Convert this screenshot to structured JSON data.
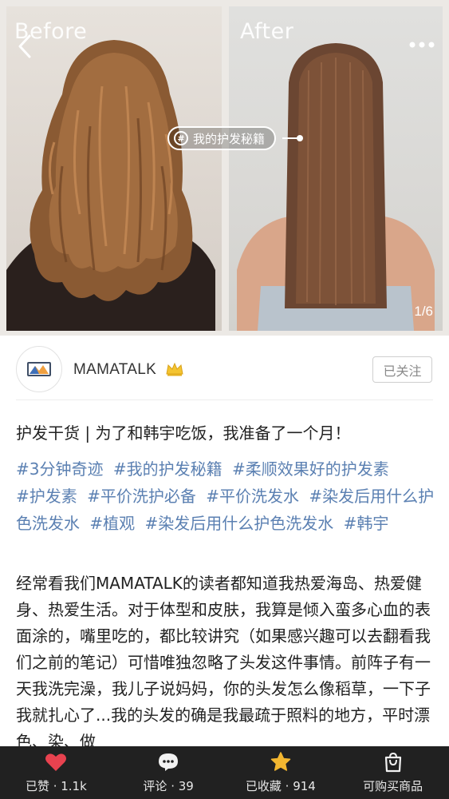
{
  "hero": {
    "before_label": "Before",
    "after_label": "After",
    "tag_chip": "我的护发秘籍",
    "page_indicator": "1/6"
  },
  "author": {
    "name": "MAMATALK",
    "follow_label": "已关注"
  },
  "post": {
    "title": "护发干货 | 为了和韩宇吃饭，我准备了一个月！",
    "tags": [
      "#3分钟奇迹",
      "#我的护发秘籍",
      "#柔顺效果好的护发素",
      "#护发素",
      "#平价洗护必备",
      "#平价洗发水",
      "#染发后用什么护色洗发水",
      "#植观",
      "#染发后用什么护色洗发水",
      "#韩宇"
    ],
    "body": "经常看我们MAMATALK的读者都知道我热爱海岛、热爱健身、热爱生活。对于体型和皮肤，我算是倾入蛮多心血的表面涂的，嘴里吃的，都比较讲究（如果感兴趣可以去翻看我们之前的笔记）可惜唯独忽略了头发这件事情。前阵子有一天我洗完澡，我儿子说妈妈，你的头发怎么像稻草，一下子我就扎心了...我的头发的确是我最疏于照料的地方，平时漂色、染、做"
  },
  "bottom_bar": {
    "like_label": "已赞 · 1.1k",
    "comment_label": "评论 · 39",
    "collect_label": "已收藏 · 914",
    "shop_label": "可购买商品"
  },
  "colors": {
    "tag_blue": "#5b80b2",
    "like_red": "#e8424f",
    "star_gold": "#f2b630",
    "bar_bg": "#212121",
    "crown_gold": "#f4c430"
  },
  "icons": {
    "back": "chevron-left-icon",
    "more": "more-dots-icon",
    "like": "heart-icon",
    "comment": "speech-bubble-icon",
    "collect": "star-icon",
    "shop": "shopping-bag-icon",
    "verified": "crown-icon"
  }
}
